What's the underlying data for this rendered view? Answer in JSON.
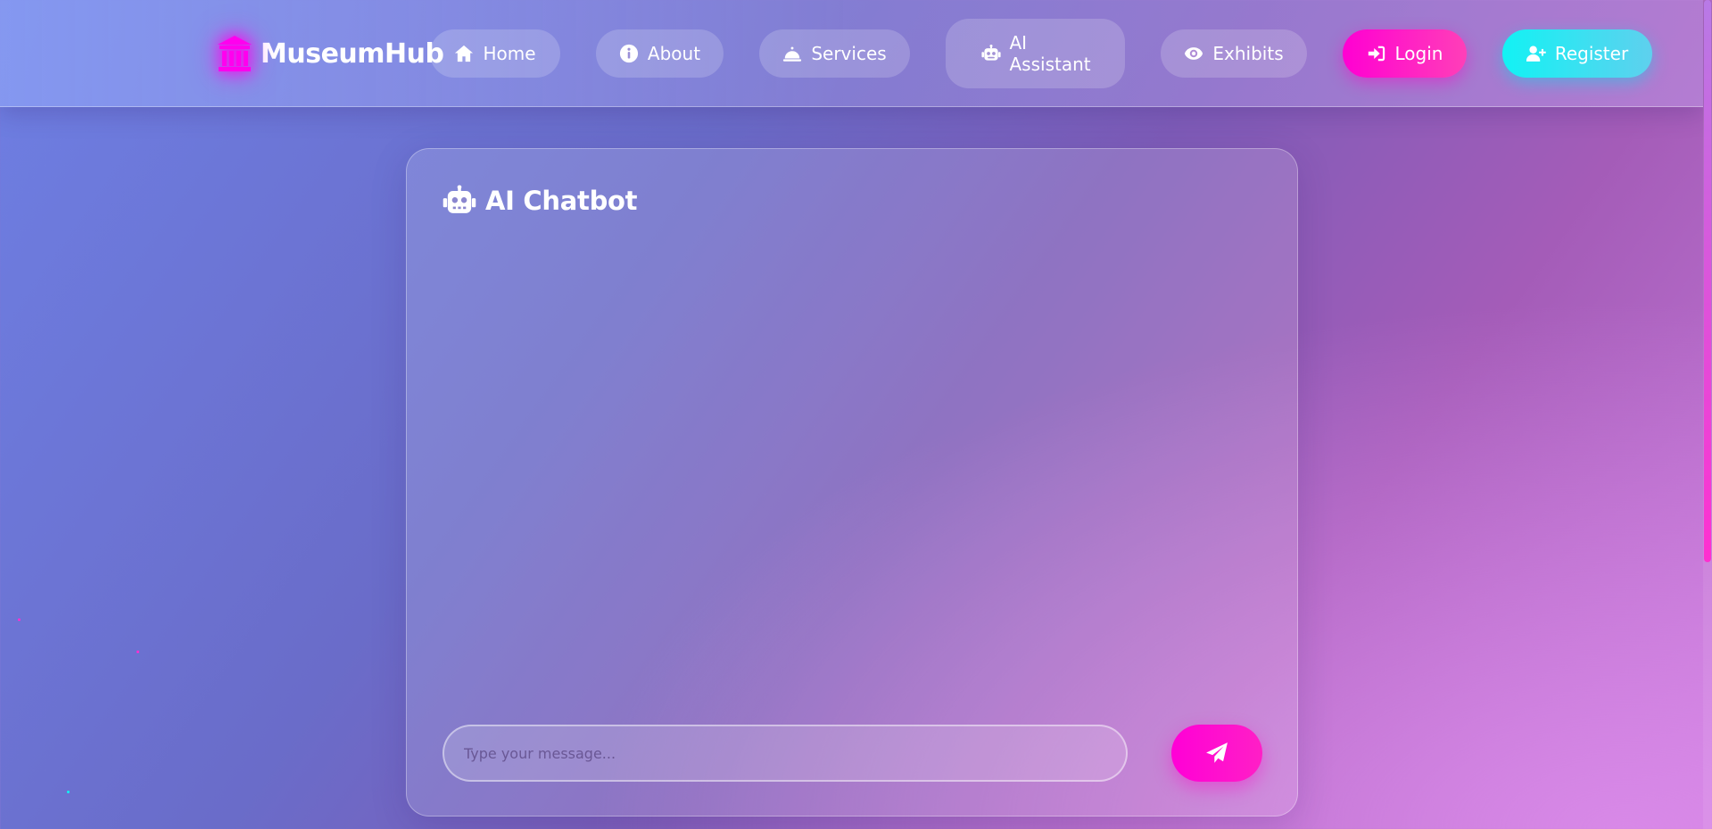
{
  "brand": {
    "name": "MuseumHub",
    "accent": "#ff00ee"
  },
  "nav": {
    "home": "Home",
    "about": "About",
    "services": "Services",
    "ai_line1": "AI",
    "ai_line2": "Assistant",
    "exhibits": "Exhibits",
    "login": "Login",
    "register": "Register"
  },
  "chat": {
    "title": "AI Chatbot",
    "input_placeholder": "Type your message...",
    "messages": []
  },
  "colors": {
    "login_gradient": [
      "#ff00d2",
      "#ff3fb8"
    ],
    "register_gradient": [
      "#12f2f4",
      "#5fd0ee"
    ],
    "send_button": "#ff00d6"
  },
  "icons": {
    "brand": "museum-icon",
    "home": "home-icon",
    "about": "info-circle-icon",
    "services": "concierge-bell-icon",
    "ai": "robot-icon",
    "exhibits": "eye-icon",
    "login": "sign-in-icon",
    "register": "user-plus-icon",
    "send": "paper-plane-icon"
  }
}
